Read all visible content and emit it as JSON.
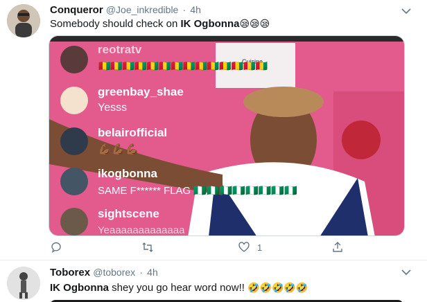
{
  "tweet1": {
    "name": "Conqueror",
    "handle": "@Joe_inkredible",
    "separator": "·",
    "time": "4h",
    "text_prefix": "Somebody should check on ",
    "text_bold": "IK Ogbonna",
    "text_emoji": "😪😪😪",
    "media": {
      "rows": [
        {
          "user": "reotratv",
          "comment": "🇬🇳🇬🇳🇬🇳🇬🇳🇬🇳🇬🇳🇬🇳🇬🇳🇬🇳🇬🇳🇬🇳🇬🇳🇬🇳🇬🇳"
        },
        {
          "user": "greenbay_shae",
          "comment": "Yesss"
        },
        {
          "user": "belairofficial",
          "comment": "💪🏾💪🏾💪🏾"
        },
        {
          "user": "ikogbonna",
          "comment": "SAME F****** FLAG 🇳🇬🇳🇬🇳🇬🇳🇬🇳🇬🇳🇬🇳🇬🇳🇬"
        },
        {
          "user": "sightscene",
          "comment": "Yeaaaaaaaaaaaaa"
        }
      ],
      "sign_text": "Cuisine"
    },
    "like_count": "1",
    "colors": {
      "pink": "#e85a8c",
      "link": "#1da1f2"
    }
  },
  "tweet2": {
    "name": "Toborex",
    "handle": "@toborex",
    "separator": "·",
    "time": "4h",
    "text_bold": "IK Ogbonna",
    "text_rest": " shey you go hear word now!! ",
    "text_emoji": "🤣🤣🤣🤣🤣"
  }
}
